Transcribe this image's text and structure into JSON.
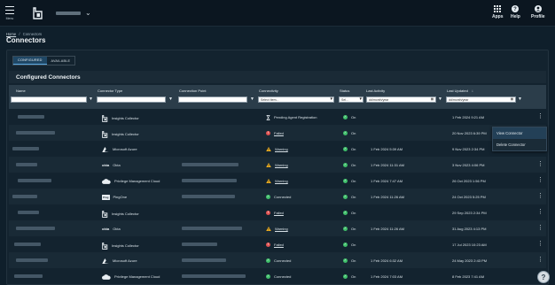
{
  "topbar": {
    "menu_label": "Menu",
    "apps_label": "Apps",
    "help_label": "Help",
    "profile_label": "Profile"
  },
  "breadcrumb": {
    "home": "Home",
    "separator": "/",
    "current": "Connectors"
  },
  "page_title": "Connectors",
  "tabs": [
    {
      "label": "CONFIGURED",
      "active": true
    },
    {
      "label": "AVAILABLE",
      "active": false
    }
  ],
  "section_title": "Configured Connectors",
  "columns": {
    "name": "Name",
    "connector_type": "Connector Type",
    "connection_point": "Connection Point",
    "connectivity": "Connectivity",
    "status": "Status",
    "last_activity": "Last Activity",
    "last_updated": "Last Updated",
    "sort_indicator": "↓"
  },
  "filters": {
    "connectivity_placeholder": "Select Item...",
    "status_placeholder": "Sel...",
    "last_activity_placeholder": "dd/month/year",
    "last_updated_placeholder": "dd/month/year"
  },
  "colors": {
    "ok": "#3fbf6a",
    "warning": "#f2b01e",
    "failed": "#e05252"
  },
  "rows": [
    {
      "type": "Insights Collector",
      "type_icon": "insights-collector-icon",
      "connectivity": "Pending Agent Registration",
      "connectivity_state": "pending",
      "status": "On",
      "last_activity": "",
      "last_updated": "1 Feb 2024 9:21 AM"
    },
    {
      "type": "Insights Collector",
      "type_icon": "insights-collector-icon",
      "connectivity": "Failed",
      "connectivity_state": "failed",
      "status": "On",
      "last_activity": "",
      "last_updated": "20 Nov 2023 6:39 PM"
    },
    {
      "type": "Microsoft Azure",
      "type_icon": "azure-icon",
      "connectivity": "Warning",
      "connectivity_state": "warning",
      "status": "On",
      "last_activity": "1 Feb 2024 5:39 AM",
      "last_updated": "9 Nov 2023 2:34 PM"
    },
    {
      "type": "Okta",
      "type_icon": "okta-icon",
      "connectivity": "Warning",
      "connectivity_state": "warning",
      "status": "On",
      "last_activity": "1 Feb 2024 11:31 AM",
      "last_updated": "3 Nov 2023 4:06 PM"
    },
    {
      "type": "Privilege Management Cloud",
      "type_icon": "pm-cloud-icon",
      "connectivity": "Warning",
      "connectivity_state": "warning",
      "status": "On",
      "last_activity": "1 Feb 2024 7:47 AM",
      "last_updated": "26 Oct 2023 1:56 PM"
    },
    {
      "type": "PingOne",
      "type_icon": "pingone-icon",
      "connectivity": "Connected",
      "connectivity_state": "ok",
      "status": "On",
      "last_activity": "1 Feb 2024 11:26 AM",
      "last_updated": "24 Oct 2023 5:25 PM"
    },
    {
      "type": "Insights Collector",
      "type_icon": "insights-collector-icon",
      "connectivity": "Failed",
      "connectivity_state": "failed",
      "status": "On",
      "last_activity": "",
      "last_updated": "29 Sep 2023 2:34 PM"
    },
    {
      "type": "Okta",
      "type_icon": "okta-icon",
      "connectivity": "Warning",
      "connectivity_state": "warning",
      "status": "On",
      "last_activity": "1 Feb 2024 11:26 AM",
      "last_updated": "31 Aug 2023 4:13 PM"
    },
    {
      "type": "Insights Collector",
      "type_icon": "insights-collector-icon",
      "connectivity": "Failed",
      "connectivity_state": "failed",
      "status": "On",
      "last_activity": "",
      "last_updated": "17 Jul 2023 10:23 AM"
    },
    {
      "type": "Microsoft Azure",
      "type_icon": "azure-icon",
      "connectivity": "Connected",
      "connectivity_state": "ok",
      "status": "On",
      "last_activity": "1 Feb 2024 6:32 AM",
      "last_updated": "24 May 2023 2:43 PM"
    },
    {
      "type": "Privilege Management Cloud",
      "type_icon": "pm-cloud-icon",
      "connectivity": "Connected",
      "connectivity_state": "ok",
      "status": "On",
      "last_activity": "1 Feb 2024 7:03 AM",
      "last_updated": "8 Feb 2023 7:41 AM"
    }
  ],
  "row_menu": {
    "view": "View Connector",
    "delete": "Delete Connector"
  },
  "help_fab": "?"
}
